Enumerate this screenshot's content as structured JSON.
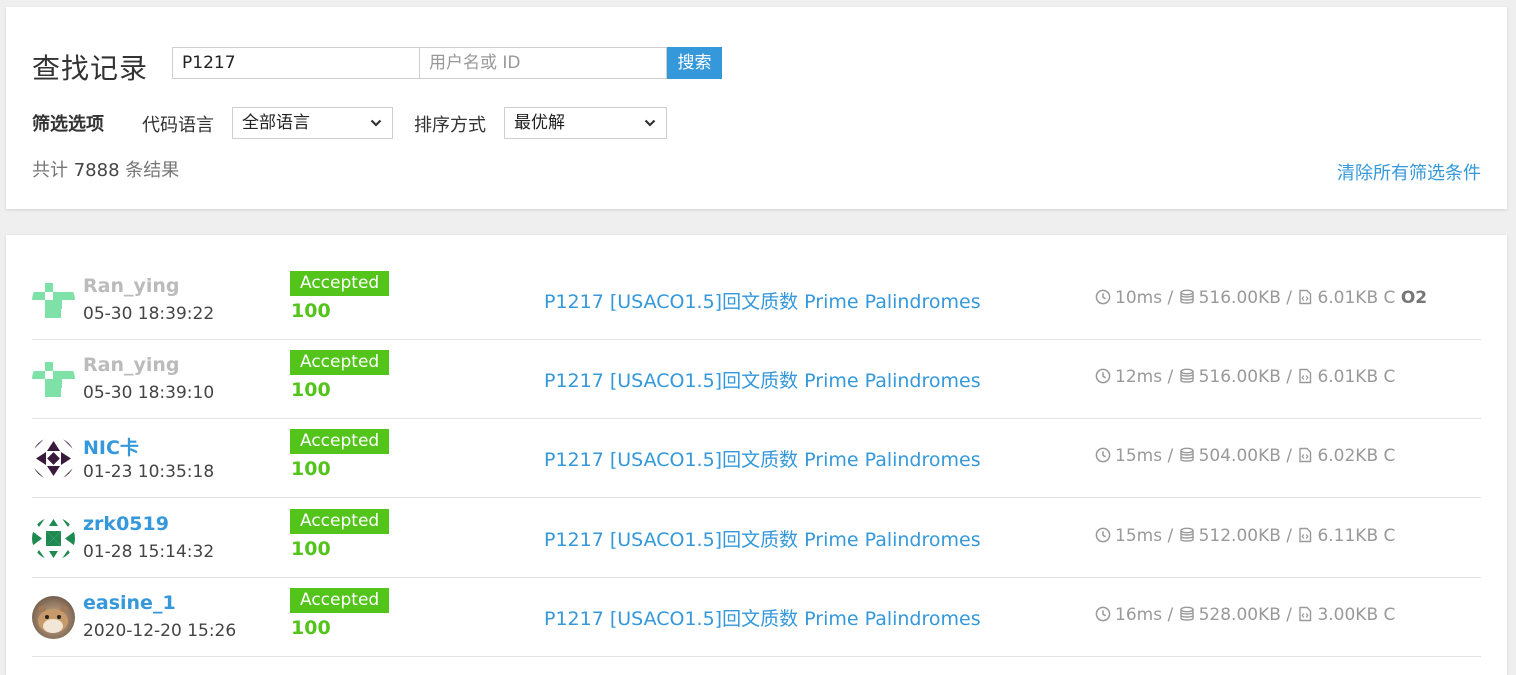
{
  "search": {
    "title": "查找记录",
    "pid_value": "P1217",
    "user_placeholder": "用户名或 ID",
    "button_label": "搜索"
  },
  "filters": {
    "label": "筛选选项",
    "language_label": "代码语言",
    "language_value": "全部语言",
    "order_label": "排序方式",
    "order_value": "最优解"
  },
  "summary": {
    "prefix": "共计",
    "count": "7888",
    "suffix": "条结果",
    "clear_label": "清除所有筛选条件"
  },
  "records": [
    {
      "user": "Ran_ying",
      "user_gray": true,
      "avatar": "pixel-green",
      "time": "05-30 18:39:22",
      "status": "Accepted",
      "score": "100",
      "problem": "P1217 [USACO1.5]回文质数 Prime Palindromes",
      "time_used": "10ms",
      "memory": "516.00KB",
      "code_size": "6.01KB",
      "lang": "C",
      "o2": "O2"
    },
    {
      "user": "Ran_ying",
      "user_gray": true,
      "avatar": "pixel-green",
      "time": "05-30 18:39:10",
      "status": "Accepted",
      "score": "100",
      "problem": "P1217 [USACO1.5]回文质数 Prime Palindromes",
      "time_used": "12ms",
      "memory": "516.00KB",
      "code_size": "6.01KB",
      "lang": "C",
      "o2": ""
    },
    {
      "user": "NIC卡",
      "user_gray": false,
      "avatar": "pattern-purple",
      "time": "01-23 10:35:18",
      "status": "Accepted",
      "score": "100",
      "problem": "P1217 [USACO1.5]回文质数 Prime Palindromes",
      "time_used": "15ms",
      "memory": "504.00KB",
      "code_size": "6.02KB",
      "lang": "C",
      "o2": ""
    },
    {
      "user": "zrk0519",
      "user_gray": false,
      "avatar": "pattern-green",
      "time": "01-28 15:14:32",
      "status": "Accepted",
      "score": "100",
      "problem": "P1217 [USACO1.5]回文质数 Prime Palindromes",
      "time_used": "15ms",
      "memory": "512.00KB",
      "code_size": "6.11KB",
      "lang": "C",
      "o2": ""
    },
    {
      "user": "easine_1",
      "user_gray": false,
      "avatar": "photo-hamster",
      "time": "2020-12-20 15:26",
      "status": "Accepted",
      "score": "100",
      "problem": "P1217 [USACO1.5]回文质数 Prime Palindromes",
      "time_used": "16ms",
      "memory": "528.00KB",
      "code_size": "3.00KB",
      "lang": "C",
      "o2": ""
    }
  ],
  "colors": {
    "accent": "#3498db",
    "accepted": "#52c41a",
    "muted_user": "#bbbbbb"
  }
}
